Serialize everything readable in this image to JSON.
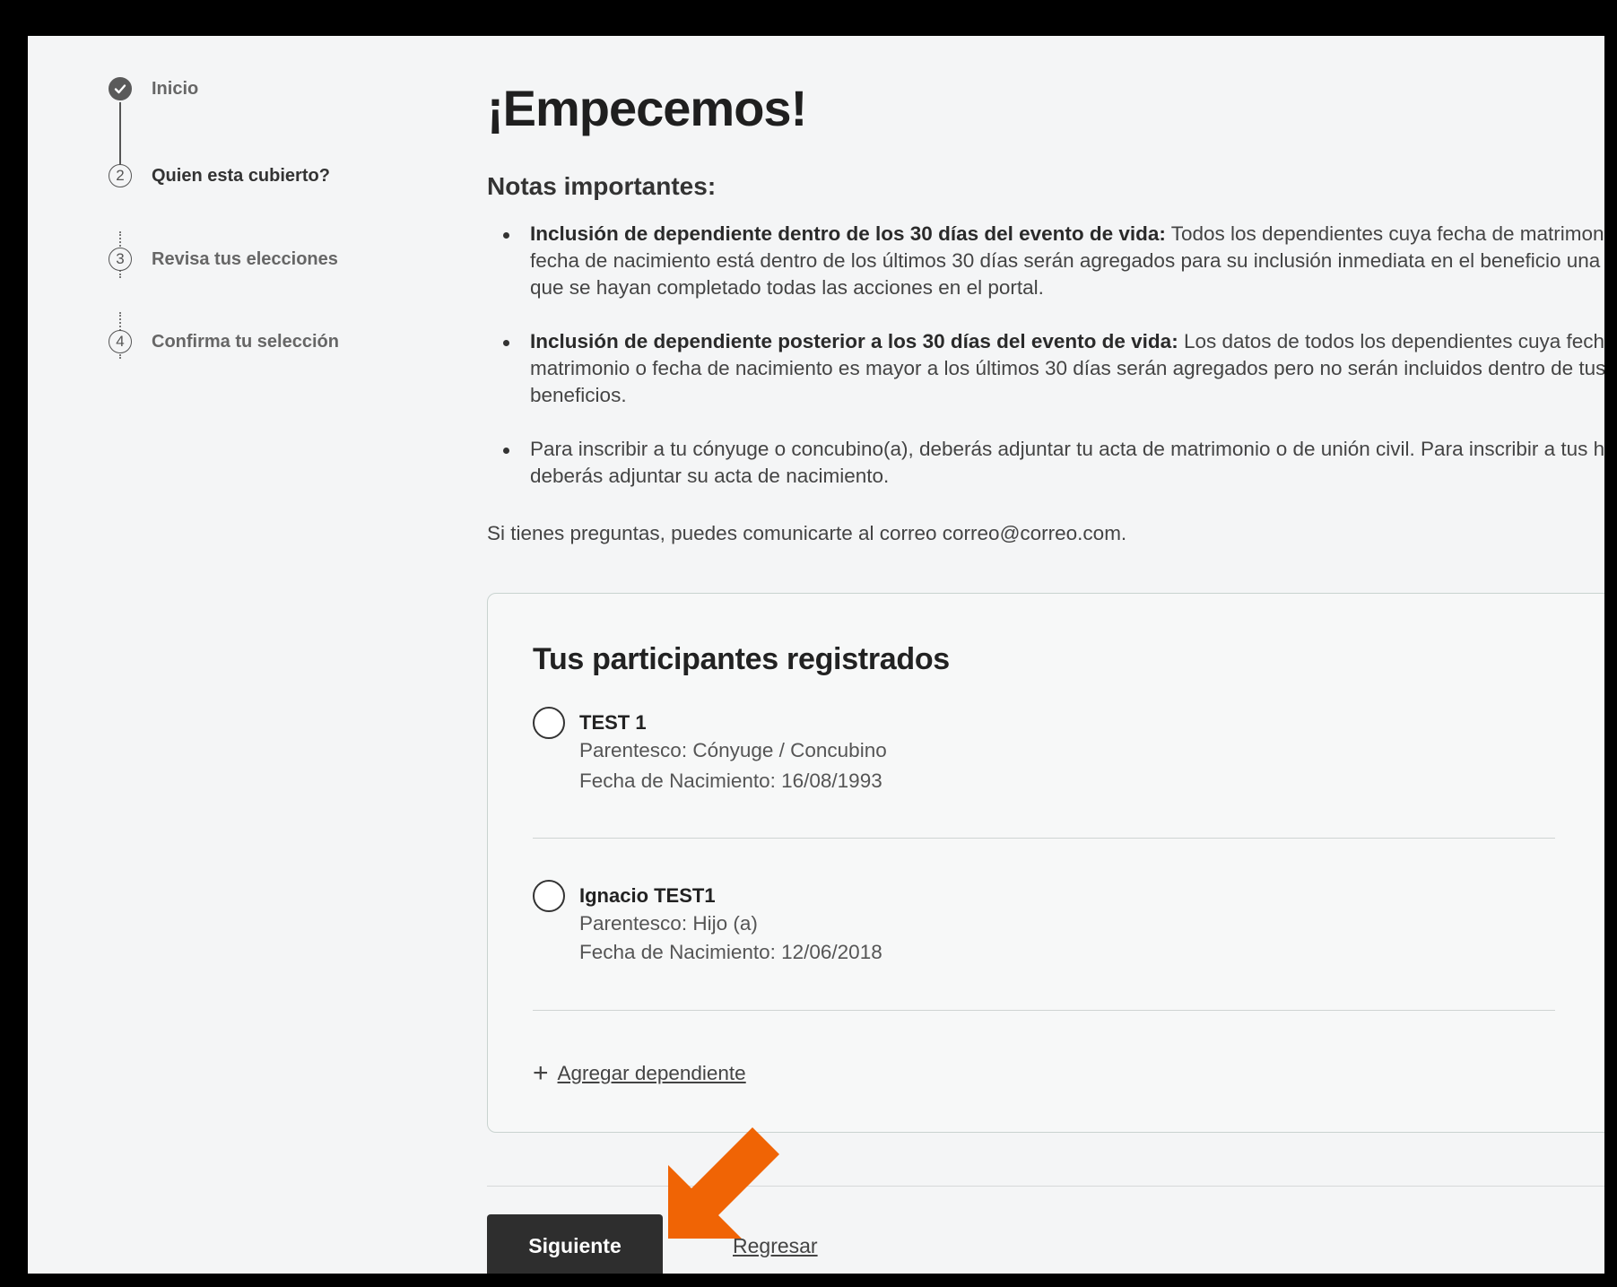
{
  "stepper": {
    "steps": [
      {
        "number": "",
        "label": "Inicio",
        "state": "done"
      },
      {
        "number": "2",
        "label": "Quien esta cubierto?",
        "state": "current"
      },
      {
        "number": "3",
        "label": "Revisa tus elecciones",
        "state": "pending"
      },
      {
        "number": "4",
        "label": "Confirma tu selección",
        "state": "pending"
      }
    ]
  },
  "main": {
    "title": "¡Empecemos!",
    "subtitle": "Notas importantes:",
    "notes": [
      {
        "bold": "Inclusión de dependiente dentro de los 30 días del evento de vida:",
        "text": " Todos los dependientes cuya fecha de matrimonio o fecha de nacimiento está dentro de los últimos 30 días serán agregados para su inclusión inmediata en el beneficio una vez que se hayan completado todas las acciones en el portal."
      },
      {
        "bold": "Inclusión de dependiente posterior a los 30 días del evento de vida:",
        "text": " Los datos de todos los dependientes cuya fecha de matrimonio o fecha de nacimiento es mayor a los últimos 30 días serán agregados pero no serán incluidos dentro de tus beneficios."
      },
      {
        "bold": "",
        "text": "Para inscribir a tu cónyuge o concubino(a), deberás adjuntar tu acta de matrimonio o de unión civil. Para inscribir a tus hijos, deberás adjuntar su acta de nacimiento."
      }
    ],
    "contact": "Si tienes preguntas, puedes comunicarte al correo correo@correo.com."
  },
  "participants_card": {
    "title": "Tus participantes registrados",
    "participants": [
      {
        "name": "TEST 1",
        "relationship": "Parentesco: Cónyuge / Concubino",
        "birthdate": "Fecha de Nacimiento: 16/08/1993"
      },
      {
        "name": "Ignacio TEST1",
        "relationship": "Parentesco: Hijo (a)",
        "birthdate": "Fecha de Nacimiento: 12/06/2018"
      }
    ],
    "add_label": "Agregar dependiente"
  },
  "actions": {
    "next_label": "Siguiente",
    "back_label": "Regresar"
  },
  "colors": {
    "primary_button": "#2e2e2e",
    "annotation_arrow": "#f06405",
    "background": "#f4f5f6"
  }
}
